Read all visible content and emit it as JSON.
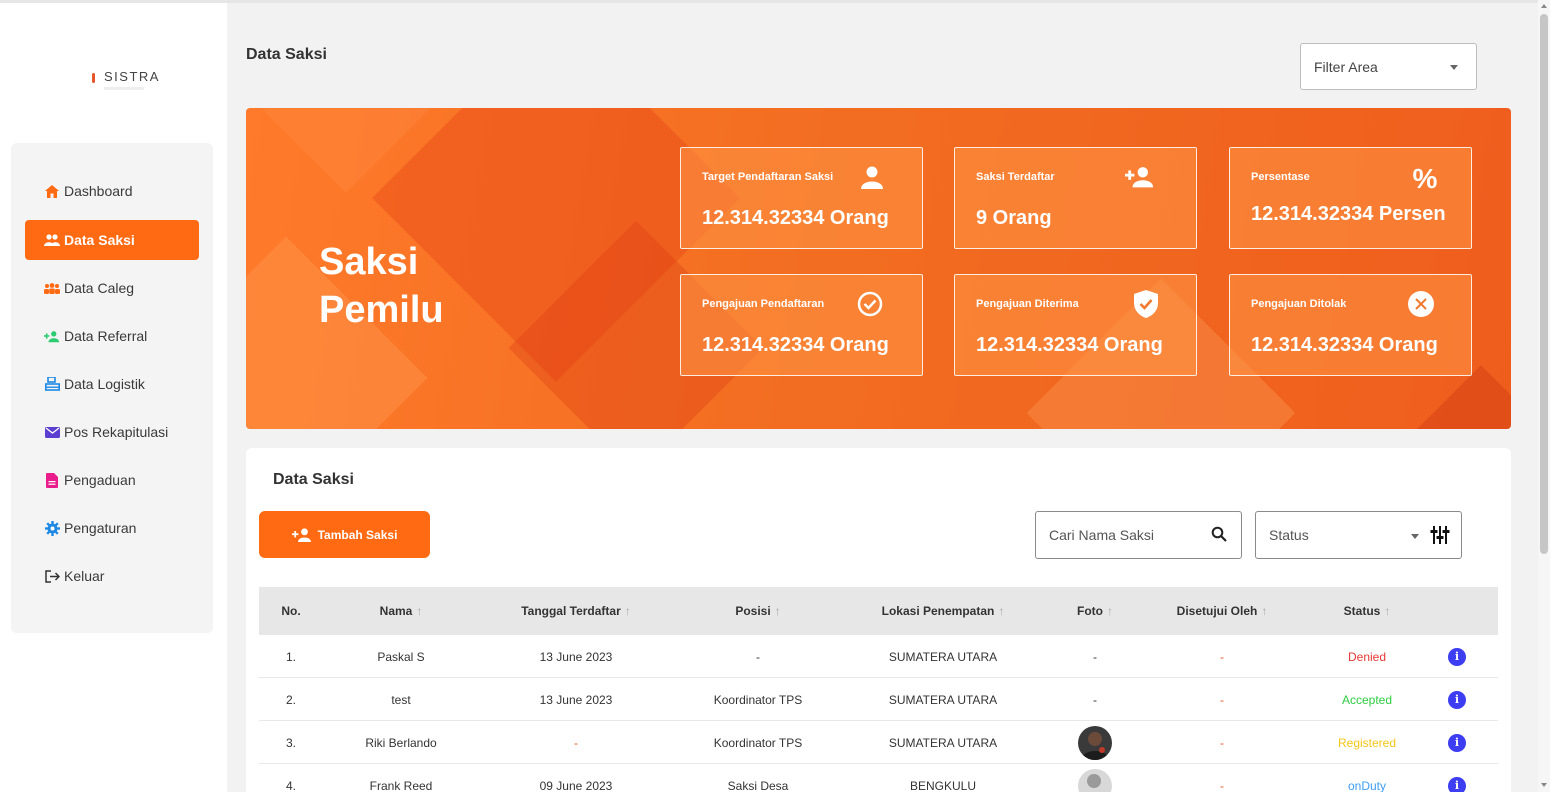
{
  "app": {
    "logo_text": "SISTRA"
  },
  "sidebar": {
    "items": [
      {
        "label": "Dashboard",
        "icon": "home-icon",
        "active": false
      },
      {
        "label": "Data Saksi",
        "icon": "users-icon",
        "active": true
      },
      {
        "label": "Data Caleg",
        "icon": "group-icon",
        "active": false
      },
      {
        "label": "Data Referral",
        "icon": "user-plus-icon",
        "active": false
      },
      {
        "label": "Data Logistik",
        "icon": "boxes-icon",
        "active": false
      },
      {
        "label": "Pos Rekapitulasi",
        "icon": "envelope-icon",
        "active": false
      },
      {
        "label": "Pengaduan",
        "icon": "file-icon",
        "active": false
      },
      {
        "label": "Pengaturan",
        "icon": "gear-icon",
        "active": false
      },
      {
        "label": "Keluar",
        "icon": "logout-icon",
        "active": false
      }
    ]
  },
  "header": {
    "title": "Data Saksi",
    "filter_label": "Filter Area"
  },
  "banner": {
    "title_line1": "Saksi",
    "title_line2": "Pemilu",
    "cards": [
      {
        "label": "Target Pendaftaran Saksi",
        "value": "12.314.32334 Orang",
        "icon": "user-icon"
      },
      {
        "label": "Saksi Terdaftar",
        "value": "9 Orang",
        "icon": "user-plus-icon"
      },
      {
        "label": "Persentase",
        "value": "12.314.32334 Persen",
        "icon": "percent-icon"
      },
      {
        "label": "Pengajuan Pendaftaran",
        "value": "12.314.32334 Orang",
        "icon": "check-circle-icon"
      },
      {
        "label": "Pengajuan Diterima",
        "value": "12.314.32334 Orang",
        "icon": "shield-check-icon"
      },
      {
        "label": "Pengajuan Ditolak",
        "value": "12.314.32334 Orang",
        "icon": "x-circle-icon"
      }
    ]
  },
  "table_section": {
    "title": "Data Saksi",
    "add_button": "Tambah Saksi",
    "search_placeholder": "Cari Nama Saksi",
    "status_label": "Status",
    "sort_arrow": "↑",
    "columns": [
      "No.",
      "Nama",
      "Tanggal Terdaftar",
      "Posisi",
      "Lokasi Penempatan",
      "Foto",
      "Disetujui Oleh",
      "Status"
    ],
    "rows": [
      {
        "no": "1.",
        "nama": "Paskal S",
        "tanggal": "13 June 2023",
        "posisi": "-",
        "lokasi": "SUMATERA UTARA",
        "foto": "-",
        "disetujui": "-",
        "status": "Denied",
        "status_color": "#e53935"
      },
      {
        "no": "2.",
        "nama": "test",
        "tanggal": "13 June 2023",
        "posisi": "Koordinator TPS",
        "lokasi": "SUMATERA UTARA",
        "foto": "-",
        "disetujui": "-",
        "status": "Accepted",
        "status_color": "#2ecc40"
      },
      {
        "no": "3.",
        "nama": "Riki Berlando",
        "tanggal": "-",
        "posisi": "Koordinator TPS",
        "lokasi": "SUMATERA UTARA",
        "foto": "photo",
        "disetujui": "-",
        "status": "Registered",
        "status_color": "#f5c518"
      },
      {
        "no": "4.",
        "nama": "Frank Reed",
        "tanggal": "09 June 2023",
        "posisi": "Saksi Desa",
        "lokasi": "BENGKULU",
        "foto": "photo",
        "disetujui": "-",
        "status": "onDuty",
        "status_color": "#3d9cf5"
      }
    ]
  },
  "colors": {
    "accent": "#ff6a13",
    "info": "#3d3df2"
  }
}
